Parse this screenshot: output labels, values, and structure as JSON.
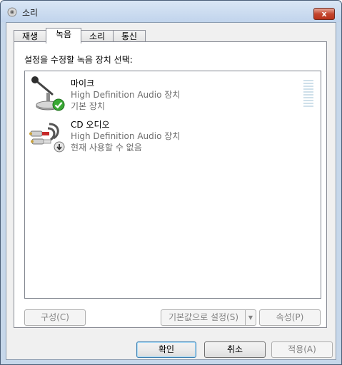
{
  "window": {
    "title": "소리",
    "close_symbol": "x"
  },
  "tabs": [
    {
      "label": "재생"
    },
    {
      "label": "녹음"
    },
    {
      "label": "소리"
    },
    {
      "label": "통신"
    }
  ],
  "panel": {
    "instruction": "설정을 수정할 녹음 장치 선택:"
  },
  "devices": [
    {
      "name": "마이크",
      "driver": "High Definition Audio 장치",
      "status": "기본 장치",
      "icon": "microphone-icon",
      "badge": "green-check-icon"
    },
    {
      "name": "CD 오디오",
      "driver": "High Definition Audio 장치",
      "status": "현재 사용할 수 없음",
      "icon": "audio-cable-icon",
      "badge": "down-arrow-icon"
    }
  ],
  "buttons": {
    "configure": "구성(C)",
    "set_default": "기본값으로 설정(S)",
    "properties": "속성(P)",
    "ok": "확인",
    "cancel": "취소",
    "apply": "적용(A)"
  }
}
